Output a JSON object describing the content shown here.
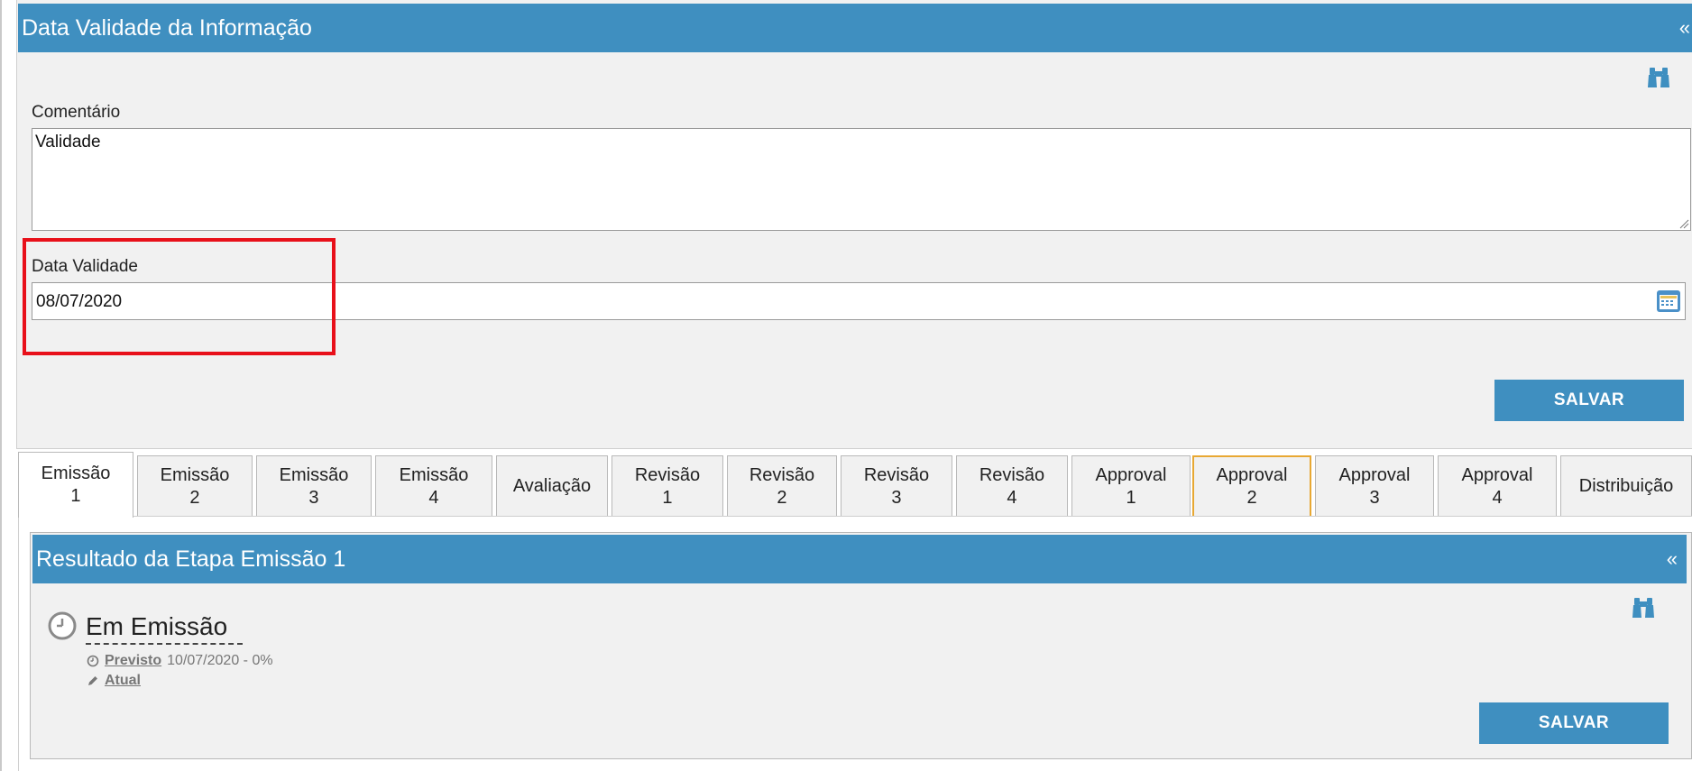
{
  "panel1": {
    "title": "Data Validade da Informação",
    "collapse": "«",
    "comment_label": "Comentário",
    "comment_value": "Validade",
    "date_label": "Data Validade",
    "date_value": "08/07/2020",
    "save_label": "SALVAR"
  },
  "tabs": [
    {
      "line1": "Emissão",
      "line2": "1"
    },
    {
      "line1": "Emissão",
      "line2": "2"
    },
    {
      "line1": "Emissão",
      "line2": "3"
    },
    {
      "line1": "Emissão",
      "line2": "4"
    },
    {
      "line1": "Avaliação",
      "line2": ""
    },
    {
      "line1": "Revisão",
      "line2": "1"
    },
    {
      "line1": "Revisão",
      "line2": "2"
    },
    {
      "line1": "Revisão",
      "line2": "3"
    },
    {
      "line1": "Revisão",
      "line2": "4"
    },
    {
      "line1": "Approval",
      "line2": "1"
    },
    {
      "line1": "Approval",
      "line2": "2"
    },
    {
      "line1": "Approval",
      "line2": "3"
    },
    {
      "line1": "Approval",
      "line2": "4"
    },
    {
      "line1": "Distribuição",
      "line2": ""
    }
  ],
  "panel2": {
    "title": "Resultado da Etapa Emissão 1",
    "collapse": "«",
    "status": "Em Emissão",
    "planned_label": "Previsto",
    "planned_value": "10/07/2020 - 0%",
    "current_label": "Atual",
    "save_label": "SALVAR"
  },
  "colors": {
    "header": "#3f8fc0",
    "highlight": "#e8101a",
    "tab_focus": "#e8a833"
  },
  "icons": [
    "binoculars-icon",
    "calendar-icon",
    "clock-icon",
    "pencil-icon",
    "collapse-icon"
  ]
}
